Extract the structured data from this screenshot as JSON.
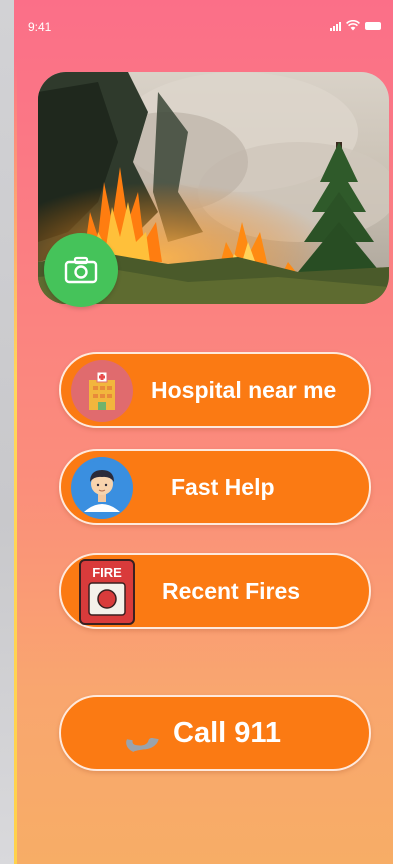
{
  "status_bar": {
    "time": "9:41"
  },
  "hero": {
    "camera_icon": "camera-icon"
  },
  "actions": [
    {
      "label": "Hospital near me",
      "icon": "hospital-icon"
    },
    {
      "label": "Fast Help",
      "icon": "person-avatar-icon"
    },
    {
      "label": "Recent Fires",
      "icon": "fire-alarm-icon",
      "icon_text": "FIRE"
    },
    {
      "label": "Call 911",
      "icon": "phone-icon"
    }
  ],
  "colors": {
    "button": "#fb7a13",
    "camera_button": "#45c35a",
    "gradient_top": "#fb6f88",
    "gradient_bottom": "#f7ad66"
  }
}
